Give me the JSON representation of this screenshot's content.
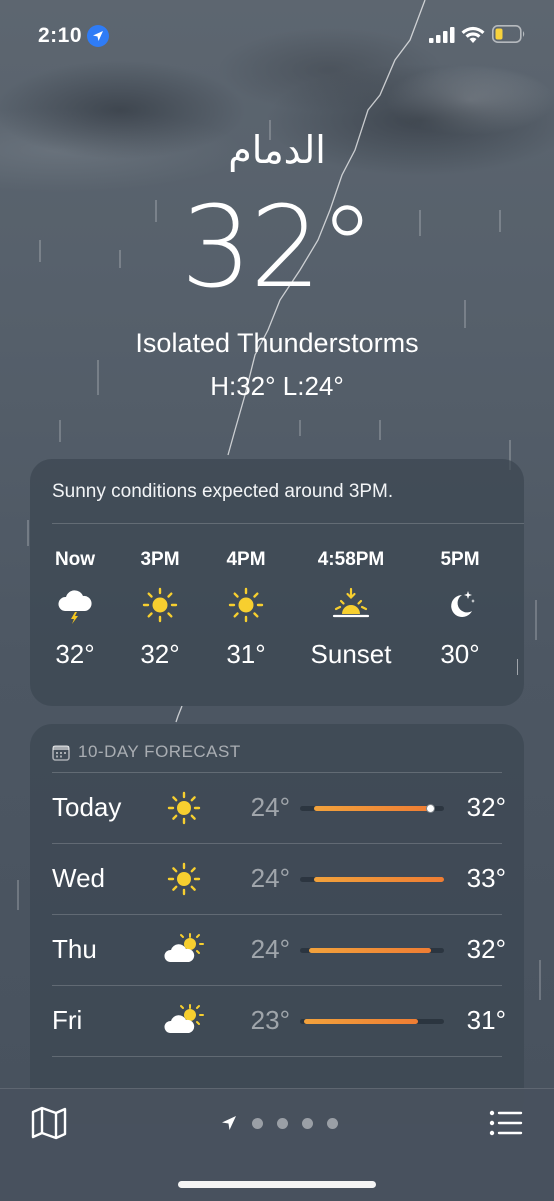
{
  "status_bar": {
    "time": "2:10"
  },
  "header": {
    "city": "الدمام",
    "temperature": "32°",
    "condition": "Isolated Thunderstorms",
    "high_low": "H:32°  L:24°"
  },
  "hourly": {
    "summary": "Sunny conditions expected around 3PM.",
    "items": [
      {
        "label": "Now",
        "icon": "thunderstorm-icon",
        "value": "32°"
      },
      {
        "label": "3PM",
        "icon": "sun-icon",
        "value": "32°"
      },
      {
        "label": "4PM",
        "icon": "sun-icon",
        "value": "31°"
      },
      {
        "label": "4:58PM",
        "icon": "sunset-icon",
        "value": "Sunset"
      },
      {
        "label": "5PM",
        "icon": "moon-stars-icon",
        "value": "30°"
      }
    ]
  },
  "forecast": {
    "title": "10-DAY FORECAST",
    "range": [
      23,
      33
    ],
    "days": [
      {
        "day": "Today",
        "icon": "sun-icon",
        "low": "24°",
        "high": "32°",
        "low_value": 24,
        "high_value": 32,
        "current_value": 32
      },
      {
        "day": "Wed",
        "icon": "sun-icon",
        "low": "24°",
        "high": "33°",
        "low_value": 24,
        "high_value": 33
      },
      {
        "day": "Thu",
        "icon": "partly-cloudy-icon",
        "low": "24°",
        "high": "32°",
        "low_value": 23.6,
        "high_value": 32.1
      },
      {
        "day": "Fri",
        "icon": "partly-cloudy-icon",
        "low": "23°",
        "high": "31°",
        "low_value": 23.3,
        "high_value": 31.2
      }
    ]
  },
  "bottom_bar": {
    "page_count": 4
  },
  "colors": {
    "bar_start": "#f2a23c",
    "bar_end": "#ef7d33",
    "location_blue": "#2f7cf6",
    "battery_yellow": "#f7d23c"
  }
}
